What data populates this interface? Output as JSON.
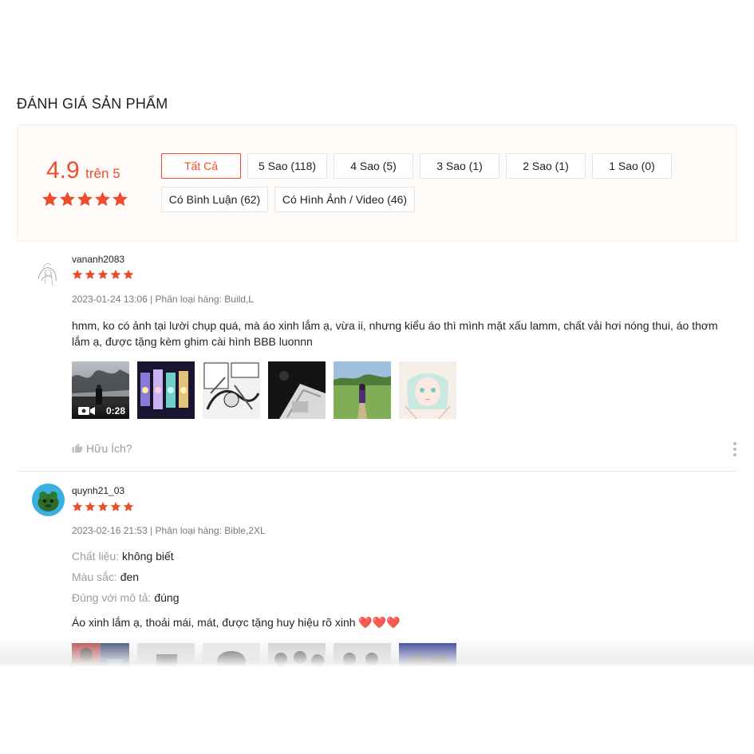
{
  "section": {
    "title": "ĐÁNH GIÁ SẢN PHẨM"
  },
  "summary": {
    "score": "4.9",
    "out_of": "trên 5",
    "stars": 5,
    "filters": [
      {
        "label": "Tất Cả",
        "active": true
      },
      {
        "label": "5 Sao (118)",
        "active": false
      },
      {
        "label": "4 Sao (5)",
        "active": false
      },
      {
        "label": "3 Sao (1)",
        "active": false
      },
      {
        "label": "2 Sao (1)",
        "active": false
      },
      {
        "label": "1 Sao (0)",
        "active": false
      },
      {
        "label": "Có Bình Luận (62)",
        "active": false
      },
      {
        "label": "Có Hình Ảnh / Video (46)",
        "active": false
      }
    ]
  },
  "reviews": [
    {
      "username": "vananh2083",
      "rating": 5,
      "meta": "2023-01-24 13:06 | Phân loại hàng: Build,L",
      "comment": "hmm, ko có ảnh tại lười chụp quá, mà áo xinh lắm ạ, vừa ii, nhưng kiểu áo thì mình mặt xấu lamm, chất vải hơi nóng thui, áo thơm lắm ạ, được tặng kèm ghim cài hình BBB luonnn",
      "video_duration": "0:28",
      "helpful_label": "Hữu Ích?"
    },
    {
      "username": "quynh21_03",
      "rating": 5,
      "meta": "2023-02-16 21:53 | Phân loại hàng: Bible,2XL",
      "attributes": [
        {
          "key": "Chất liệu:",
          "value": "không biết"
        },
        {
          "key": "Màu sắc:",
          "value": "đen"
        },
        {
          "key": "Đúng với mô tả:",
          "value": "đúng"
        }
      ],
      "comment": "Áo xinh lắm ạ, thoải mái, mát, được tặng huy hiệu rõ xinh ❤️❤️❤️"
    }
  ],
  "colors": {
    "accent": "#ee4d2d",
    "summary_bg": "#fffbf8"
  }
}
